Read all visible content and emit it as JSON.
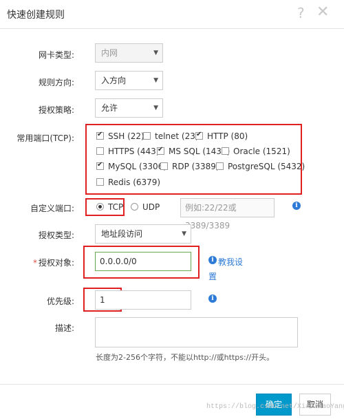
{
  "dialog": {
    "title": "快速创建规则",
    "help_glyph": "?",
    "close_glyph": "✕"
  },
  "form": {
    "nic_type": {
      "label": "网卡类型:",
      "value": "内网"
    },
    "direction": {
      "label": "规则方向:",
      "value": "入方向"
    },
    "policy": {
      "label": "授权策略:",
      "value": "允许"
    },
    "common_ports": {
      "label": "常用端口(TCP):",
      "items": [
        {
          "label": "SSH (22)",
          "checked": true
        },
        {
          "label": "telnet (23)",
          "checked": false
        },
        {
          "label": "HTTP (80)",
          "checked": true
        },
        {
          "label": "HTTPS (443)",
          "checked": false
        },
        {
          "label": "MS SQL (1433)",
          "checked": true
        },
        {
          "label": "Oracle (1521)",
          "checked": false
        },
        {
          "label": "MySQL (3306)",
          "checked": true
        },
        {
          "label": "RDP (3389)",
          "checked": false
        },
        {
          "label": "PostgreSQL (5432)",
          "checked": false
        },
        {
          "label": "Redis (6379)",
          "checked": false
        }
      ]
    },
    "custom_port": {
      "label": "自定义端口:",
      "protocols": [
        {
          "label": "TCP",
          "selected": true
        },
        {
          "label": "UDP",
          "selected": false
        }
      ],
      "placeholder": "例如:22/22或3389/3389"
    },
    "auth_type": {
      "label": "授权类型:",
      "value": "地址段访问"
    },
    "auth_object": {
      "required_mark": "*",
      "label": "授权对象:",
      "value": "0.0.0.0/0",
      "help_link_line1": "教我设",
      "help_link_line2": "置"
    },
    "priority": {
      "label": "优先级:",
      "value": "1"
    },
    "description": {
      "label": "描述:",
      "value": "",
      "hint": "长度为2-256个字符，不能以http://或https://开头。"
    }
  },
  "footer": {
    "confirm_label": "确定",
    "cancel_label": "取消"
  },
  "watermark": "https://blog.csdn.net/XiaoXiaoYang7"
}
